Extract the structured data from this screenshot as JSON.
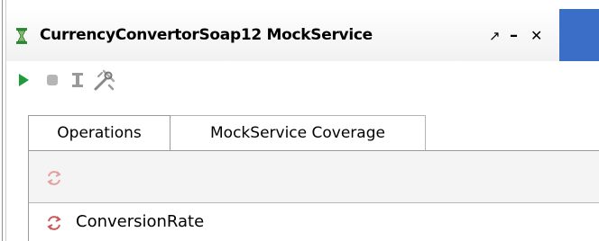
{
  "window": {
    "title": "CurrencyConvertorSoap12 MockService",
    "icon": "mock-service-icon",
    "controls": {
      "detach": "↗",
      "minimize": "–",
      "close": "✕"
    },
    "accent_color": "#3b6fc7"
  },
  "toolbar": {
    "items": [
      "run-icon",
      "stop-icon",
      "options-icon",
      "settings-icon"
    ]
  },
  "tabs": [
    {
      "label": "Operations",
      "selected": true
    },
    {
      "label": "MockService Coverage",
      "selected": false
    }
  ],
  "operations": {
    "items": [
      {
        "label": "ConversionRate",
        "icon": "operation-icon"
      }
    ]
  }
}
